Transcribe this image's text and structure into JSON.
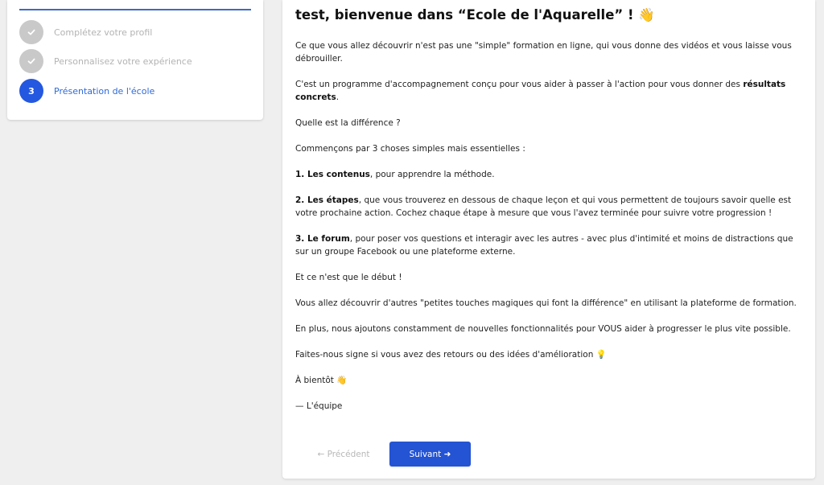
{
  "colors": {
    "accent": "#2458e0",
    "accent_button": "#2453d3",
    "step_done": "#c9c9c9",
    "step_active_text": "#2f6ad8",
    "background": "#efefef"
  },
  "steps": [
    {
      "label": "Complétez votre profil",
      "status": "done",
      "icon": "check-icon"
    },
    {
      "label": "Personnalisez votre expérience",
      "status": "done",
      "icon": "check-icon"
    },
    {
      "label": "Présentation de l'école",
      "status": "active",
      "number": "3"
    }
  ],
  "welcome": {
    "title_text": "test, bienvenue dans “Ecole de l'Aquarelle” !",
    "title_emoji": "👋",
    "p1": "Ce que vous allez découvrir n'est pas une \"simple\" formation en ligne, qui vous donne des vidéos et vous laisse vous débrouiller.",
    "p2_text": "C'est un programme d'accompagnement conçu pour vous aider à passer à l'action pour vous donner des ",
    "p2_bold": "résultats concrets",
    "p2_end": ".",
    "p3": "Quelle est la différence ?",
    "p4": "Commençons par 3 choses simples mais essentielles :",
    "item1_bold": "1. Les contenus",
    "item1_text": ", pour apprendre la méthode.",
    "item2_bold": "2. Les étapes",
    "item2_text": ", que vous trouverez en dessous de chaque leçon et qui vous permettent de toujours savoir quelle est votre prochaine action. Cochez chaque étape à mesure que vous l'avez terminée pour suivre votre progression !",
    "item3_bold": "3. Le forum",
    "item3_text": ", pour poser vos questions et interagir avec les autres - avec plus d'intimité et moins de distractions que sur un groupe Facebook ou une plateforme externe.",
    "p5": "Et ce n'est que le début !",
    "p6": "Vous allez découvrir d'autres \"petites touches magiques qui font la différence\" en utilisant la plateforme de formation.",
    "p7": "En plus, nous ajoutons constamment de nouvelles fonctionnalités pour VOUS aider à progresser le plus vite possible.",
    "p8_text": "Faites-nous signe si vous avez des retours ou des idées d'amélioration",
    "p8_emoji": "💡",
    "p9_text": "À bientôt",
    "p9_emoji": "👋",
    "signature": "— L'équipe"
  },
  "nav": {
    "prev_label": "← Précédent",
    "next_label": "Suivant ➜"
  }
}
